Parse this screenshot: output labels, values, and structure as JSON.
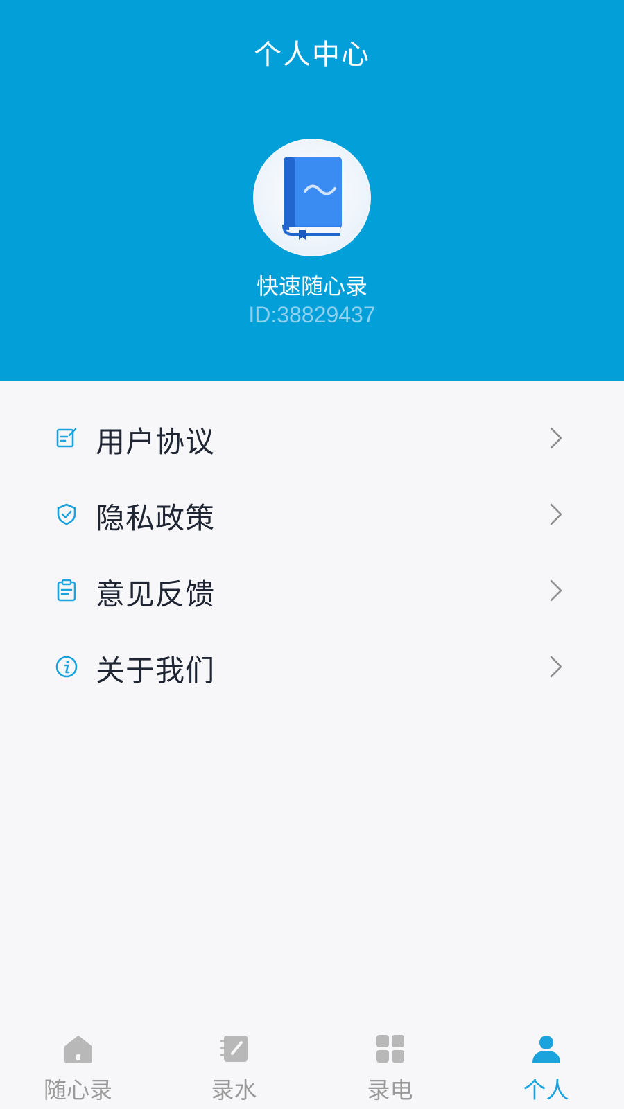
{
  "header": {
    "title": "个人中心",
    "profile": {
      "avatar_icon": "book-icon",
      "name": "快速随心录",
      "id": "ID:38829437"
    }
  },
  "menu": {
    "items": [
      {
        "label": "用户协议",
        "icon": "edit-document-icon"
      },
      {
        "label": "隐私政策",
        "icon": "shield-check-icon"
      },
      {
        "label": "意见反馈",
        "icon": "clipboard-icon"
      },
      {
        "label": "关于我们",
        "icon": "info-icon"
      }
    ]
  },
  "tabbar": {
    "tabs": [
      {
        "label": "随心录",
        "icon": "home-icon",
        "active": false
      },
      {
        "label": "录水",
        "icon": "notebook-pen-icon",
        "active": false
      },
      {
        "label": "录电",
        "icon": "grid-icon",
        "active": false
      },
      {
        "label": "个人",
        "icon": "person-icon",
        "active": true
      }
    ]
  },
  "colors": {
    "header_bg": "#039fd9",
    "accent": "#1aa3dd",
    "inactive_tab": "#9a9a9a",
    "page_bg": "#f7f7f9"
  }
}
